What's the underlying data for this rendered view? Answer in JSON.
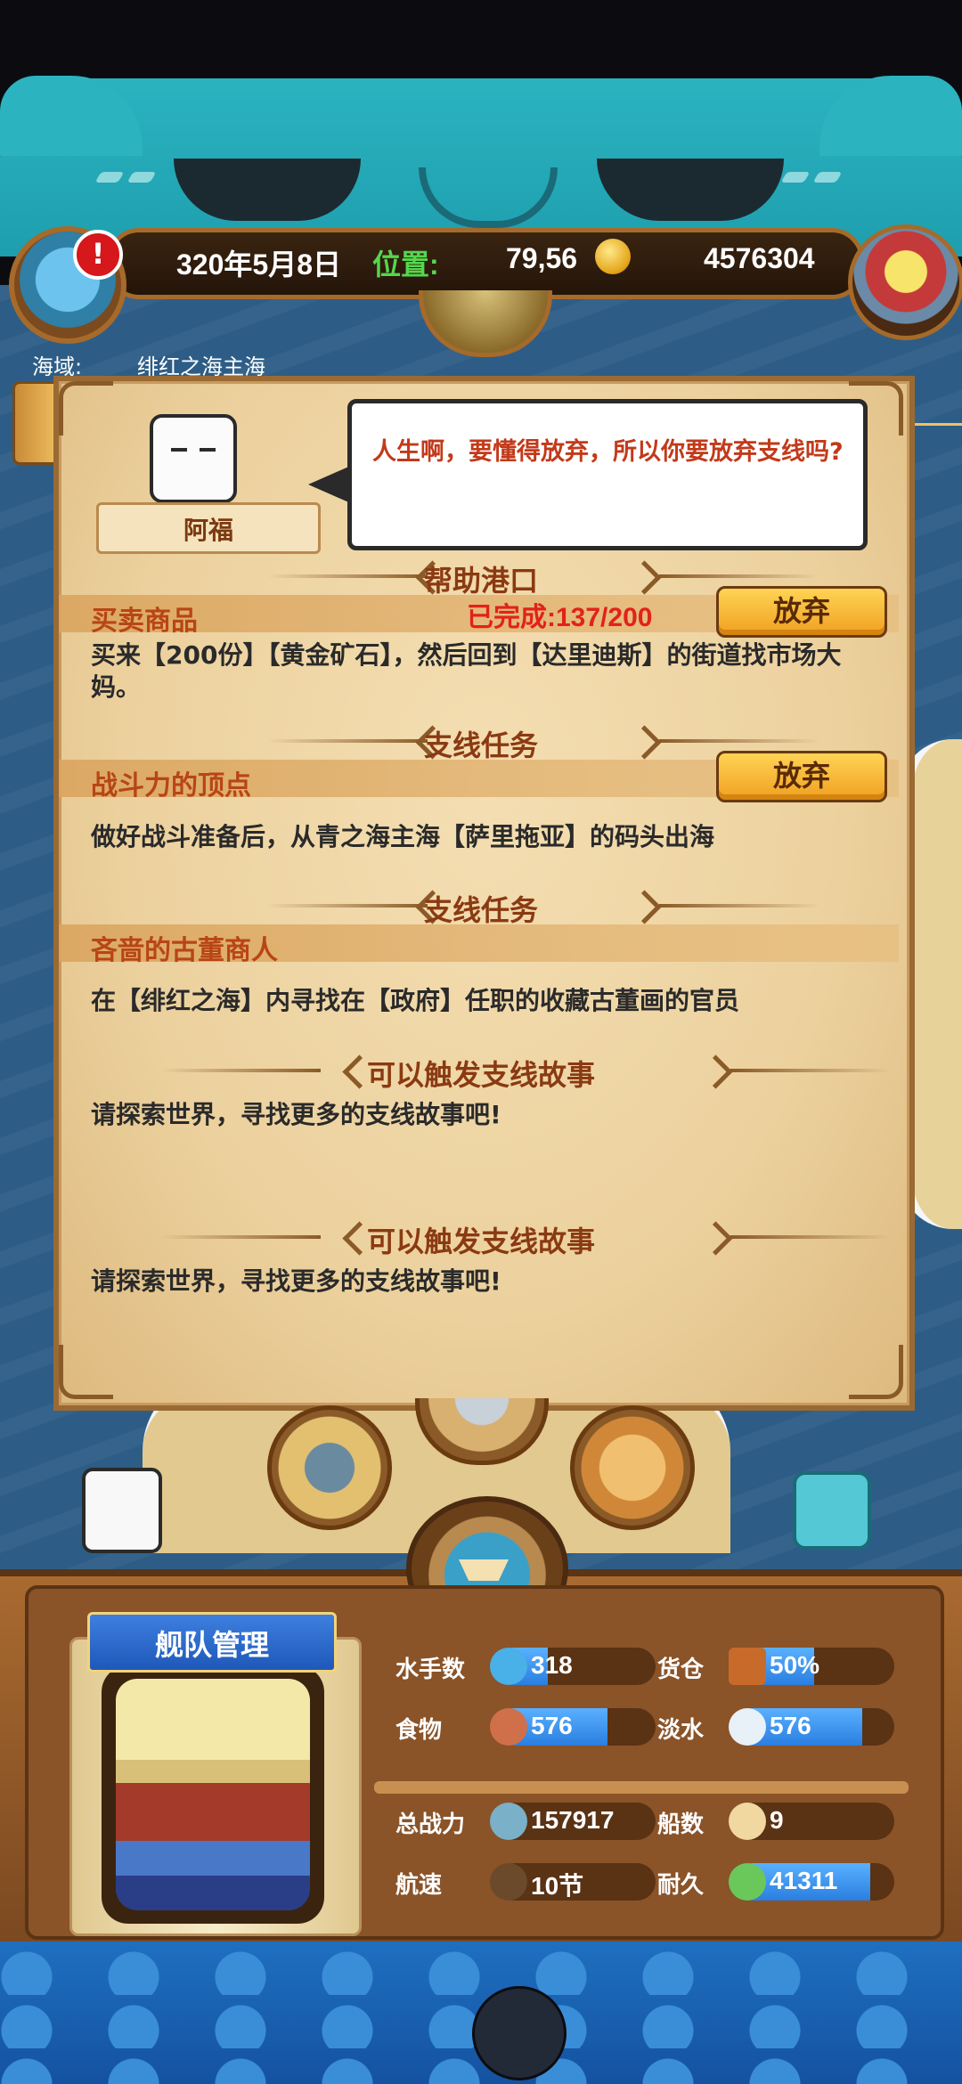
{
  "hud": {
    "date": "320年5月8日",
    "location_label": "位置:",
    "location_value": "79,56",
    "gold": "4576304",
    "alert": "!"
  },
  "region": {
    "label": "海域:",
    "value": "绯红之海主海"
  },
  "npc": {
    "name": "阿福",
    "speech": "人生啊，要懂得放弃，所以你要放弃支线吗?"
  },
  "quests": [
    {
      "section": "帮助港口",
      "name": "买卖商品",
      "progress": "已完成:137/200",
      "description": "买来【200份】【黄金矿石】，然后回到【达里迪斯】的街道找市场大妈。",
      "button": "放弃"
    },
    {
      "section": "支线任务",
      "name": "战斗力的顶点",
      "description": "做好战斗准备后，从青之海主海【萨里拖亚】的码头出海",
      "button": "放弃"
    },
    {
      "section": "支线任务",
      "name": "吝啬的古董商人",
      "description": "在【绯红之海】内寻找在【政府】任职的收藏古董画的官员"
    },
    {
      "section": "可以触发支线故事",
      "description": "请探索世界，寻找更多的支线故事吧!"
    },
    {
      "section": "可以触发支线故事",
      "description": "请探索世界，寻找更多的支线故事吧!"
    }
  ],
  "fleet": {
    "title": "舰队管理",
    "stats": {
      "sailors": {
        "label": "水手数",
        "value": "318",
        "fill": 0.33
      },
      "cargo": {
        "label": "货仓",
        "value": "50%",
        "fill": 0.5
      },
      "food": {
        "label": "食物",
        "value": "576",
        "fill": 0.7
      },
      "water": {
        "label": "淡水",
        "value": "576",
        "fill": 0.8
      },
      "power": {
        "label": "总战力",
        "value": "157917",
        "fill": 0
      },
      "ships": {
        "label": "船数",
        "value": "9",
        "fill": 0
      },
      "speed": {
        "label": "航速",
        "value": "10节",
        "fill": 0
      },
      "durability": {
        "label": "耐久",
        "value": "41311",
        "fill": 0.85
      }
    }
  },
  "icons": {
    "gold": "gold-coin-icon",
    "chest": "treasure-chest-icon",
    "telescope": "telescope-icon",
    "anchor": "anchor-icon",
    "globe": "globe-icon",
    "helm": "ship-helm-icon"
  },
  "colors": {
    "accent_red": "#e2221a",
    "location_green": "#55d64e",
    "quest_brown": "#b84515",
    "button_gold": "#f0a020",
    "stat_blue": "#2a7ee0"
  }
}
